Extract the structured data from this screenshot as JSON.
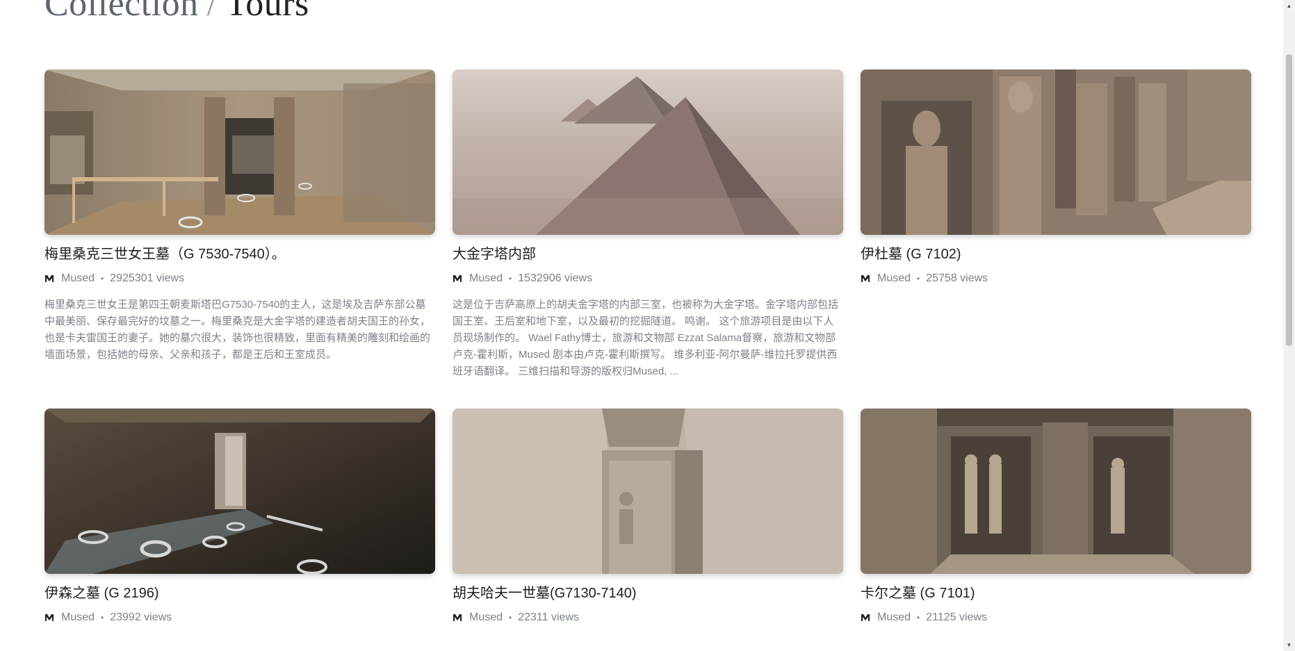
{
  "heading": {
    "section": "Collection",
    "separator": "/",
    "current": "Tours"
  },
  "tours": [
    {
      "title": "梅里桑克三世女王墓（G 7530-7540）。",
      "author": "Mused",
      "views": "2925301 views",
      "description": "梅里桑克三世女王是第四王朝麦斯塔巴G7530-7540的主人，这是埃及吉萨东部公墓中最美丽、保存最完好的坟墓之一。梅里桑克是大金字塔的建造者胡夫国王的孙女，也是卡夫雷国王的妻子。她的墓穴很大，装饰也很精致，里面有精美的雕刻和绘画的墙面场景，包括她的母亲、父亲和孩子，都是王后和王室成员。"
    },
    {
      "title": "大金字塔内部",
      "author": "Mused",
      "views": "1532906 views",
      "description": "这是位于吉萨高原上的胡夫金字塔的内部三室，也被称为大金字塔。金字塔内部包括国王室、王后室和地下室，以及最初的挖掘隧道。 鸣谢。 这个旅游项目是由以下人员现场制作的。 Wael Fathy博士，旅游和文物部 Ezzat Salama督察，旅游和文物部 卢克-霍利斯，Mused 剧本由卢克-霍利斯撰写。 维多利亚-阿尔曼萨-维拉托罗提供西班牙语翻译。 三维扫描和导游的版权归Mused, ..."
    },
    {
      "title": "伊杜墓 (G 7102)",
      "author": "Mused",
      "views": "25758 views",
      "description": ""
    },
    {
      "title": "伊森之墓 (G 2196)",
      "author": "Mused",
      "views": "23992 views",
      "description": ""
    },
    {
      "title": "胡夫哈夫一世墓(G7130-7140)",
      "author": "Mused",
      "views": "22311 views",
      "description": ""
    },
    {
      "title": "卡尔之墓 (G 7101)",
      "author": "Mused",
      "views": "21125 views",
      "description": ""
    }
  ],
  "meta_separator": "•",
  "icons": {
    "brand": "mused-logo-icon",
    "scroll_up": "scroll-up-arrow-icon",
    "scroll_down": "scroll-down-arrow-icon"
  },
  "colors": {
    "heading_muted": "#5c6470",
    "text_muted": "#7b8089",
    "title": "#1e1e1e"
  }
}
